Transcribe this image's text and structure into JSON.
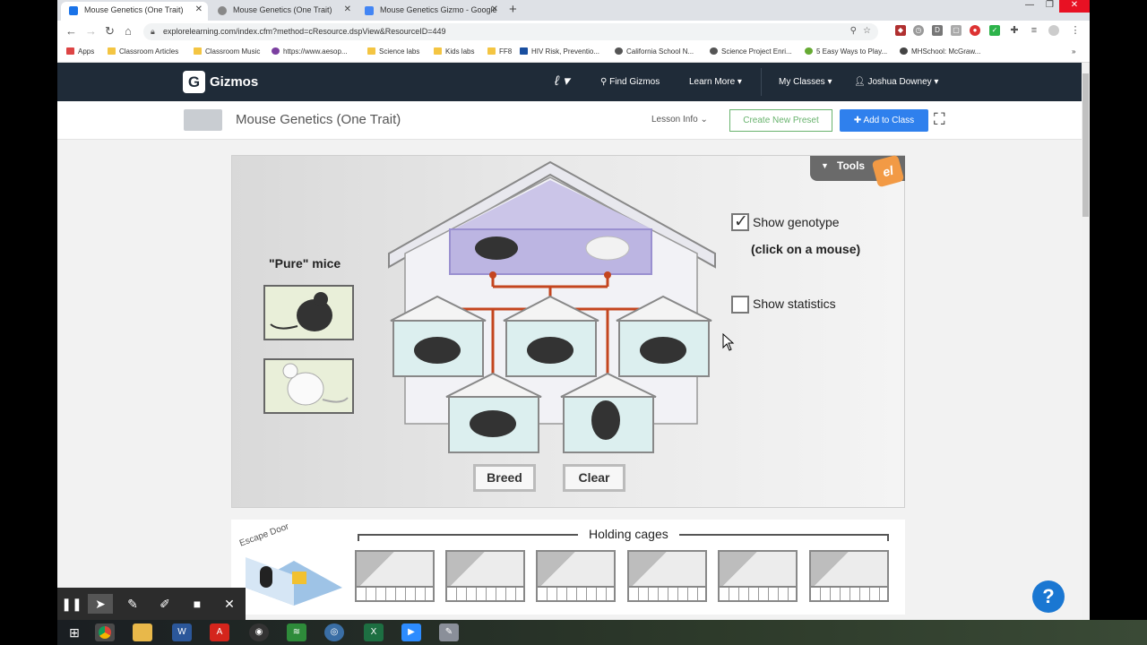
{
  "tabs": [
    {
      "title": "Mouse Genetics (One Trait)",
      "active": true
    },
    {
      "title": "Mouse Genetics (One Trait)",
      "active": false
    },
    {
      "title": "Mouse Genetics Gizmo - Google",
      "active": false
    }
  ],
  "address": {
    "url": "explorelearning.com/index.cfm?method=cResource.dspView&ResourceID=449"
  },
  "bookmarks": [
    "Apps",
    "Classroom Articles",
    "Classroom Music",
    "https://www.aesop...",
    "Science labs",
    "Kids labs",
    "FF8",
    "HIV Risk, Preventio...",
    "California School N...",
    "Science Project Enri...",
    "5 Easy Ways to Play...",
    "MHSchool: McGraw..."
  ],
  "gizmo_nav": {
    "brand": "Gizmos",
    "find": "Find Gizmos",
    "learn": "Learn More",
    "classes": "My Classes",
    "user": "Joshua Downey"
  },
  "header": {
    "title": "Mouse Genetics (One Trait)",
    "lesson_info": "Lesson Info",
    "create_preset": "Create New Preset",
    "add_to_class": "Add to Class"
  },
  "sim": {
    "tools": "Tools",
    "pure_label": "\"Pure\" mice",
    "show_genotype": "Show genotype",
    "show_genotype_checked": true,
    "click_hint": "(click on a mouse)",
    "show_statistics": "Show statistics",
    "show_statistics_checked": false,
    "breed": "Breed",
    "clear": "Clear",
    "holding_cages": "Holding cages",
    "escape_door": "Escape Door"
  },
  "colors": {
    "nav_bg": "#1f2b38",
    "accent_blue": "#2f80ed",
    "preset_green": "#69b36e",
    "line_red": "#c4451f",
    "roof_purple": "#b3aee0"
  }
}
